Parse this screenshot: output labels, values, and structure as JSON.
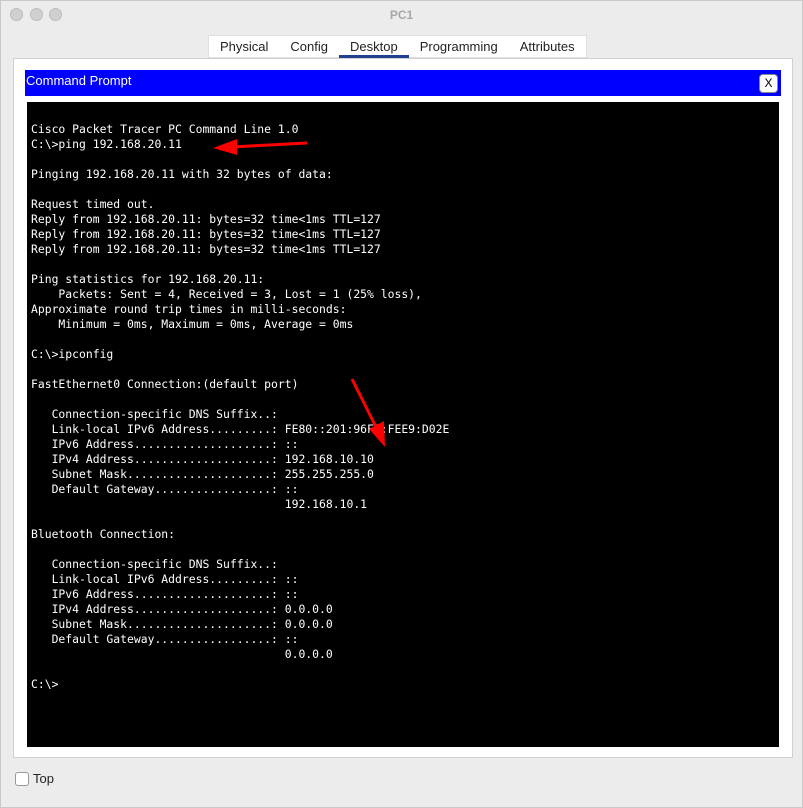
{
  "window": {
    "title": "PC1"
  },
  "tabs": [
    {
      "label": "Physical"
    },
    {
      "label": "Config"
    },
    {
      "label": "Desktop",
      "active": true
    },
    {
      "label": "Programming"
    },
    {
      "label": "Attributes"
    }
  ],
  "command_prompt": {
    "title": "Command Prompt",
    "close_label": "X",
    "lines": [
      "Cisco Packet Tracer PC Command Line 1.0",
      "C:\\>ping 192.168.20.11",
      "",
      "Pinging 192.168.20.11 with 32 bytes of data:",
      "",
      "Request timed out.",
      "Reply from 192.168.20.11: bytes=32 time<1ms TTL=127",
      "Reply from 192.168.20.11: bytes=32 time<1ms TTL=127",
      "Reply from 192.168.20.11: bytes=32 time<1ms TTL=127",
      "",
      "Ping statistics for 192.168.20.11:",
      "    Packets: Sent = 4, Received = 3, Lost = 1 (25% loss),",
      "Approximate round trip times in milli-seconds:",
      "    Minimum = 0ms, Maximum = 0ms, Average = 0ms",
      "",
      "C:\\>ipconfig",
      "",
      "FastEthernet0 Connection:(default port)",
      "",
      "   Connection-specific DNS Suffix..:",
      "   Link-local IPv6 Address.........: FE80::201:96FF:FEE9:D02E",
      "   IPv6 Address....................: ::",
      "   IPv4 Address....................: 192.168.10.10",
      "   Subnet Mask.....................: 255.255.255.0",
      "   Default Gateway.................: ::",
      "                                     192.168.10.1",
      "",
      "Bluetooth Connection:",
      "",
      "   Connection-specific DNS Suffix..:",
      "   Link-local IPv6 Address.........: ::",
      "   IPv6 Address....................: ::",
      "   IPv4 Address....................: 0.0.0.0",
      "   Subnet Mask.....................: 0.0.0.0",
      "   Default Gateway.................: ::",
      "                                     0.0.0.0",
      "",
      "C:\\>"
    ]
  },
  "footer": {
    "top_label": "Top",
    "top_checked": false
  },
  "colors": {
    "title_bar": "#0000ff",
    "terminal_bg": "#000000",
    "terminal_fg": "#ffffff",
    "annotation_arrow": "#ff0000",
    "active_tab": "#1f3f8f"
  }
}
